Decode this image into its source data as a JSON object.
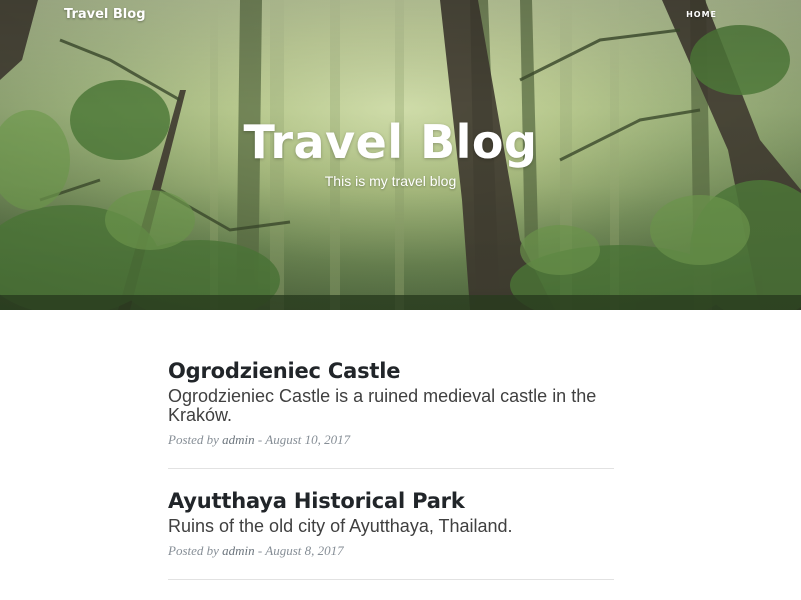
{
  "navbar": {
    "brand": "Travel Blog",
    "links": [
      {
        "label": "HOME"
      }
    ]
  },
  "hero": {
    "title": "Travel Blog",
    "subtitle": "This is my travel blog"
  },
  "posts": [
    {
      "title": "Ogrodzieniec Castle",
      "subtitle": "Ogrodzieniec Castle is a ruined medieval castle in the Kraków.",
      "posted_by": "Posted by",
      "author": "admin",
      "date": "August 10, 2017"
    },
    {
      "title": "Ayutthaya Historical Park",
      "subtitle": "Ruins of the old city of Ayutthaya, Thailand.",
      "posted_by": "Posted by",
      "author": "admin",
      "date": "August 8, 2017"
    }
  ],
  "colors": {
    "hero_light": "#d6e2b0",
    "hero_dark": "#2f4626",
    "heading": "#212529",
    "meta": "#868e96"
  }
}
